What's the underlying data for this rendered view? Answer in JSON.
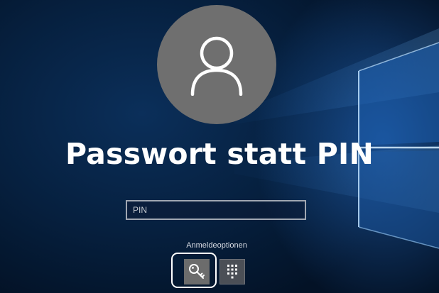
{
  "page": {
    "title": "Passwort statt PIN"
  },
  "login": {
    "pin_placeholder": "PIN",
    "options_label": "Anmeldeoptionen"
  },
  "icons": {
    "avatar": "user-icon",
    "key": "key-icon",
    "pin_pad": "pin-keypad-icon"
  },
  "colors": {
    "avatar_bg": "#6f6f6f",
    "title_text": "#ffffff",
    "key_button": "#6c6c6c",
    "pin_button": "#4b4f56",
    "highlight": "#ffffff"
  }
}
